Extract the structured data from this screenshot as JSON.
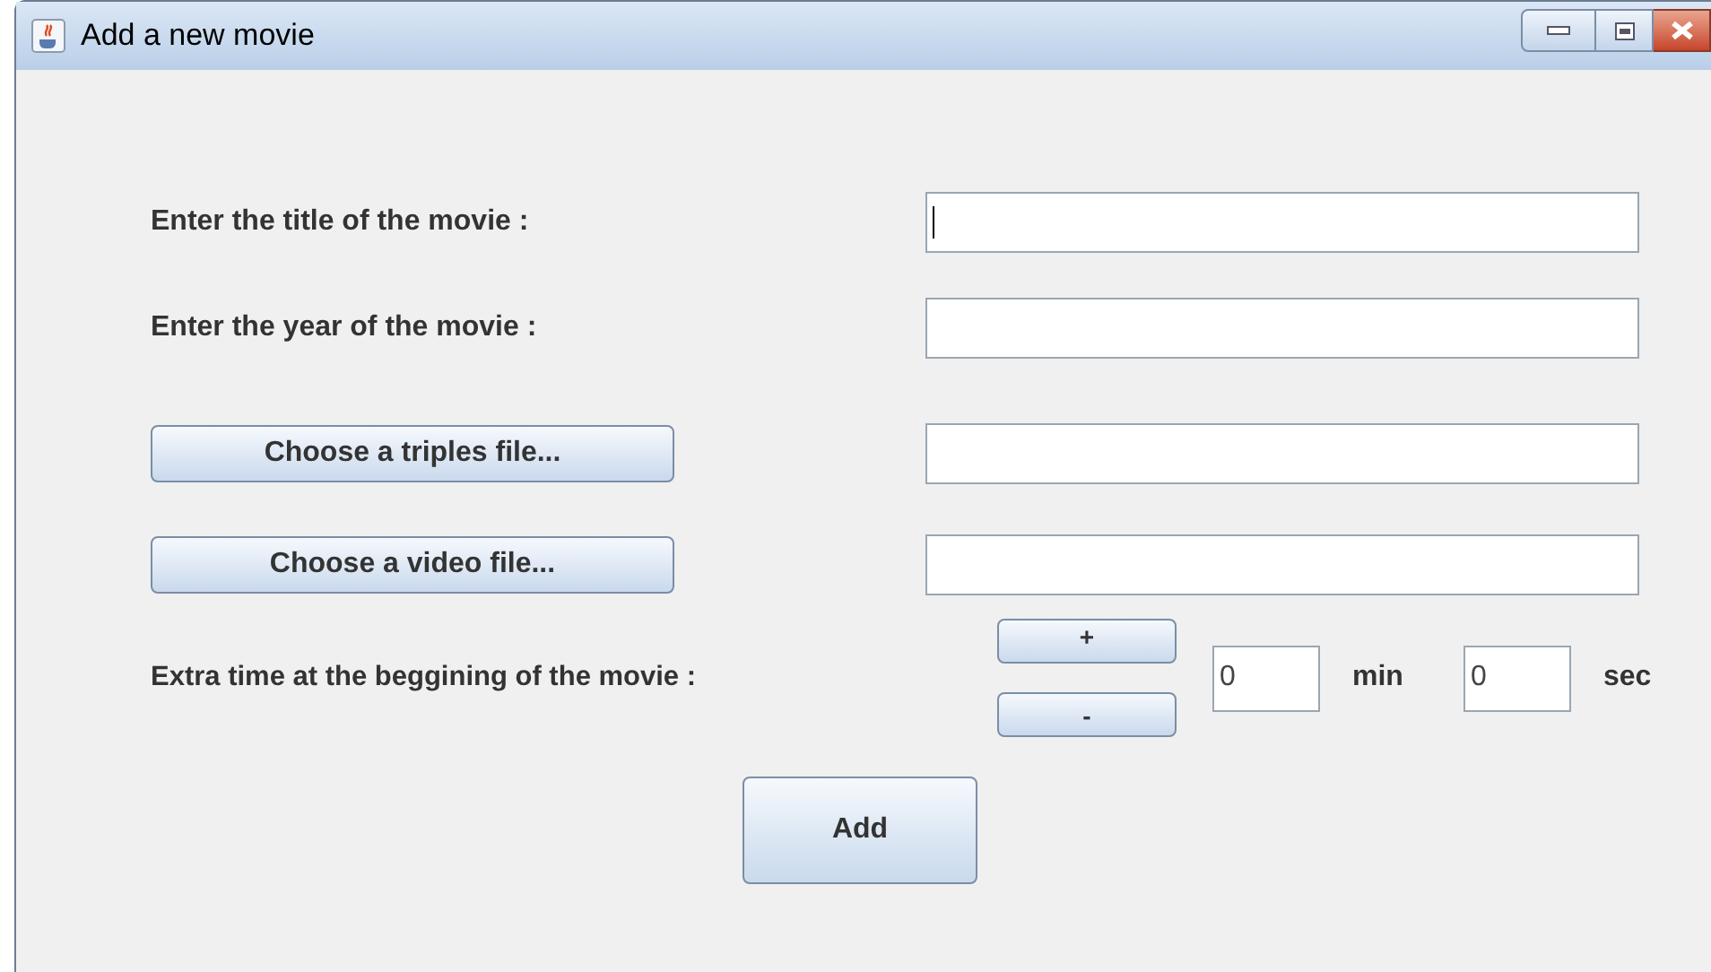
{
  "window": {
    "title": "Add a new movie"
  },
  "title_row": {
    "label": "Enter the title of the movie :",
    "focused": true
  },
  "year_row": {
    "label": "Enter the year of the movie :"
  },
  "triples_row": {
    "button": "Choose a triples file..."
  },
  "video_row": {
    "button": "Choose a video file..."
  },
  "extra_time": {
    "label": "Extra time at the beggining of the movie :",
    "plus": "+",
    "minus": "-",
    "minutes": "0",
    "min_unit": "min",
    "seconds": "0",
    "sec_unit": "sec"
  },
  "add_button": "Add"
}
